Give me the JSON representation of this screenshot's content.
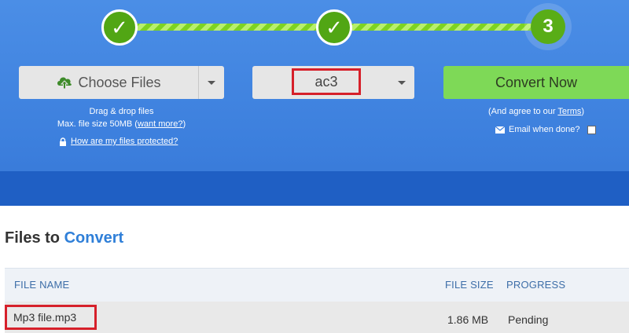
{
  "steps": [
    "✓",
    "✓",
    "3"
  ],
  "choose_files": {
    "label": "Choose Files"
  },
  "format": {
    "selected": "ac3"
  },
  "convert": {
    "label": "Convert Now"
  },
  "upload_info": {
    "line1": "Drag & drop files",
    "line2_prefix": "Max. file size 50MB (",
    "want_more": "want more?",
    "line2_suffix": ")",
    "protected_link": "How are my files protected?"
  },
  "agree": {
    "prefix": "(And agree to our ",
    "terms": "Terms",
    "suffix": ")",
    "email_label": "Email when done?"
  },
  "files_section": {
    "title_plain": "Files to ",
    "title_accent": "Convert"
  },
  "table": {
    "headers": [
      "FILE NAME",
      "FILE SIZE",
      "PROGRESS"
    ],
    "rows": [
      {
        "name": "Mp3 file.mp3",
        "size": "1.86 MB",
        "progress": "Pending"
      }
    ]
  },
  "colors": {
    "hero_blue": "#3c7fdd",
    "step_green": "#51a614",
    "convert_green": "#7ed957",
    "highlight_red": "#d6202a",
    "accent_blue": "#2f7fd8"
  }
}
